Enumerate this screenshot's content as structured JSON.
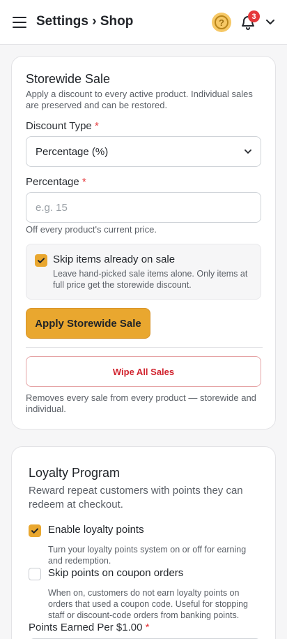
{
  "header": {
    "title": "Settings › Shop",
    "help_icon": "question-circle-icon",
    "help_glyph": "?",
    "notification_count": "3",
    "colors": {
      "accent": "#e9a72f",
      "badge": "#e5383b"
    }
  },
  "storewide_sale": {
    "title": "Storewide Sale",
    "description": "Apply a discount to every active product. Individual sales are preserved and can be restored.",
    "discount_type": {
      "label": "Discount Type",
      "required_mark": "*",
      "selected_value": "Percentage (%)"
    },
    "percentage": {
      "label": "Percentage",
      "required_mark": "*",
      "value": "",
      "placeholder": "e.g. 15",
      "hint": "Off every product's current price."
    },
    "skip_sale_items": {
      "checked": true,
      "title": "Skip items already on sale",
      "description": "Leave hand-picked sale items alone. Only items at full price get the storewide discount."
    },
    "apply_button_label": "Apply Storewide Sale",
    "wipe_button_label": "Wipe All Sales",
    "wipe_description": "Removes every sale from every product — storewide and individual."
  },
  "loyalty_program": {
    "title": "Loyalty Program",
    "description": "Reward repeat customers with points they can redeem at checkout.",
    "enable_points": {
      "checked": true,
      "title": "Enable loyalty points",
      "description": "Turn your loyalty points system on or off for earning and redemption."
    },
    "skip_coupon_orders": {
      "checked": false,
      "title": "Skip points on coupon orders",
      "description": "When on, customers do not earn loyalty points on orders that used a coupon code. Useful for stopping staff or discount-code orders from banking points."
    },
    "points_per_dollar": {
      "label": "Points Earned Per $1.00",
      "required_mark": "*"
    }
  }
}
